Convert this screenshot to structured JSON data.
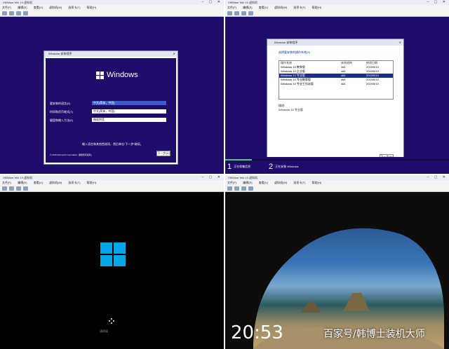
{
  "vm_window": {
    "title": "VMWare Win 10 虚拟机",
    "controls": "– ▢ ✕",
    "menu": [
      "文件(F)",
      "编辑(E)",
      "查看(V)",
      "虚拟机(M)",
      "选项卡(T)",
      "帮助(H)"
    ]
  },
  "quadrant1": {
    "dialog_title": "Windows 安装程序",
    "brand": "Windows",
    "fields": [
      {
        "label": "要安装的语言(E)",
        "value": "中文(简体，中国)"
      },
      {
        "label": "时间和货币格式(T)",
        "value": "中文(简体，中国)"
      },
      {
        "label": "键盘和输入方法(K)",
        "value": "微软拼音"
      }
    ],
    "hint": "输入语言和其他首选项，然后单击“下一步”继续。",
    "copyright": "© 2016 Microsoft Corporation. 保留所有权利。",
    "next_button": "下一步(N)"
  },
  "quadrant2": {
    "dialog_title": "Windows 安装程序",
    "prompt": "选择要安装的操作系统(S)",
    "columns": [
      "操作系统",
      "体系结构",
      "修改日期"
    ],
    "rows": [
      {
        "os": "Windows 10 教育版",
        "arch": "x64",
        "date": "2019/5/10"
      },
      {
        "os": "Windows 10 企业版",
        "arch": "x64",
        "date": "2019/5/10"
      },
      {
        "os": "Windows 10 专业版",
        "arch": "x64",
        "date": "2019/5/10",
        "selected": true
      },
      {
        "os": "Windows 10 专业教育版",
        "arch": "x64",
        "date": "2019/5/10"
      },
      {
        "os": "Windows 10 专业工作站版",
        "arch": "x64",
        "date": "2019/5/10"
      }
    ],
    "description_label": "描述:",
    "description": "Windows 10 专业版",
    "next_button": "下一步(N)",
    "progress_fraction": 0.12,
    "steps": [
      {
        "num": "1",
        "label": "正在收集信息"
      },
      {
        "num": "2",
        "label": "正在安装 Windows"
      }
    ]
  },
  "quadrant3": {
    "boot_message": "请稍候"
  },
  "quadrant4": {
    "clock": "20:53",
    "watermark": "百家号/韩博士装机大师"
  },
  "colors": {
    "setup_purple": "#1f0b6a",
    "win_blue": "#00a8e8",
    "selected_row": "#1a2f8a",
    "progress_green": "#3fd06a"
  }
}
